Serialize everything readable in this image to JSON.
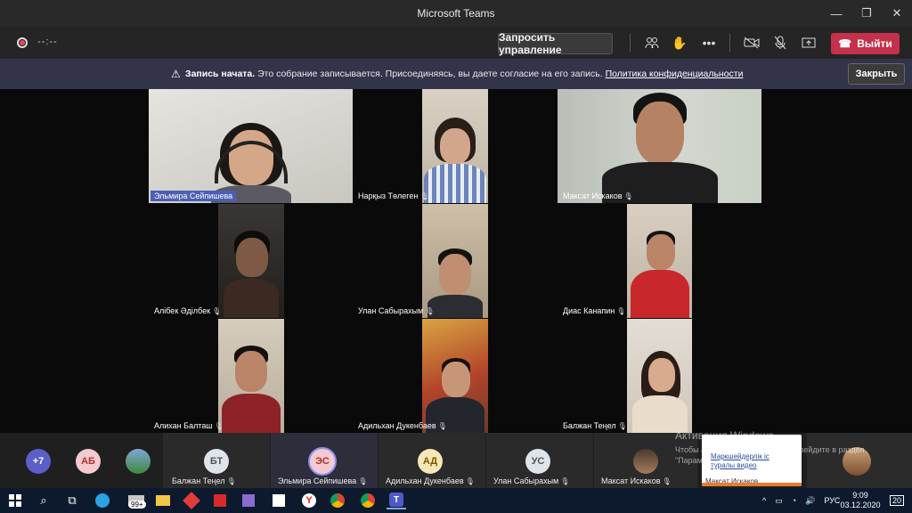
{
  "window": {
    "title": "Microsoft Teams"
  },
  "toolbar": {
    "timer": "--:--",
    "request_control_label": "Запросить управление",
    "leave_label": "Выйти"
  },
  "banner": {
    "bold": "Запись начата.",
    "text": "Это собрание записывается. Присоединяясь, вы даете согласие на его запись.",
    "link": "Политика конфиденциальности",
    "close_label": "Закрыть"
  },
  "participants": [
    {
      "name": "Эльмира Сейпишева",
      "highlight": true
    },
    {
      "name": "Нарқыз Төлеген"
    },
    {
      "name": "Максат Искаков"
    },
    {
      "name": "Алібек Әділбек"
    },
    {
      "name": "Улан Сабырахым"
    },
    {
      "name": "Диас Канапин"
    },
    {
      "name": "Алихан Балташ"
    },
    {
      "name": "Адильхан Дукенбаев"
    },
    {
      "name": "Балжан Теңел"
    }
  ],
  "strip": {
    "overflow": "+7",
    "items": [
      {
        "initials": "АБ",
        "name": ""
      },
      {
        "initials": "",
        "name": ""
      },
      {
        "initials": "БТ",
        "name": "Балжан Теңел"
      },
      {
        "initials": "ЭС",
        "name": "Эльмира Сейпишева"
      },
      {
        "initials": "АД",
        "name": "Адильхан Дукенбаев"
      },
      {
        "initials": "УС",
        "name": "Улан Сабырахым"
      },
      {
        "initials": "",
        "name": "Максат Искаков"
      }
    ]
  },
  "activation": {
    "title": "Активация Windows",
    "sub": "Чтобы активировать Windows, перейдите в раздел",
    "sub2": "\"Парам..."
  },
  "popup": {
    "line1": "Маркшейдерлік іс",
    "line2": "туралы видео",
    "line3": "Максат Искаков"
  },
  "taskbar": {
    "badge": "99+",
    "lang": "РУС",
    "time": "9:09",
    "date": "03.12.2020",
    "notif": "20"
  },
  "colors": {
    "leave": "#c4314b",
    "banner": "#33344a",
    "highlight": "#4b5fb4"
  }
}
